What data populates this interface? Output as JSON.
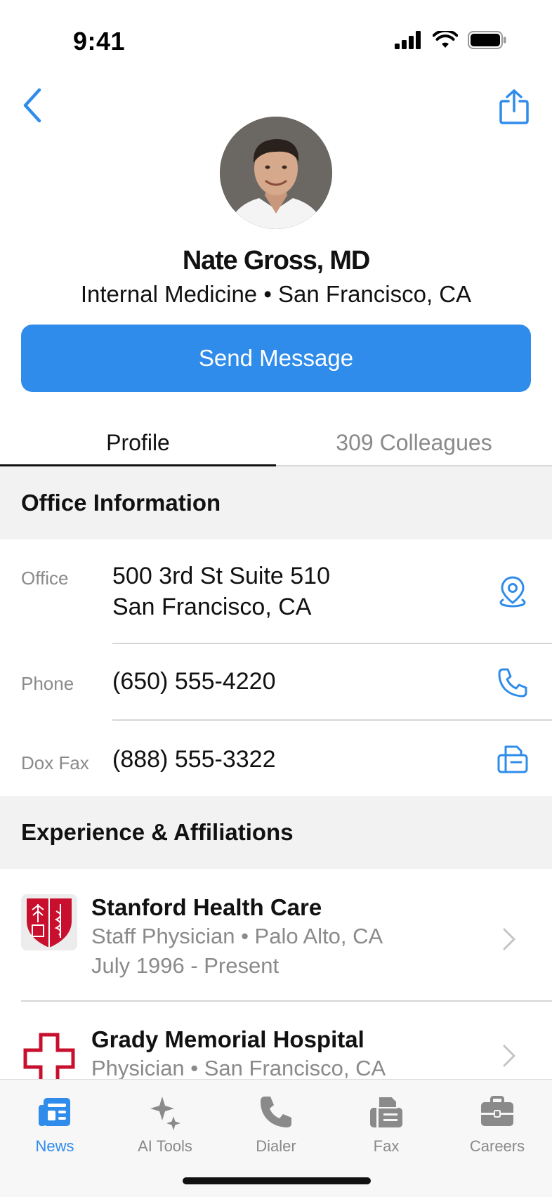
{
  "status": {
    "time": "9:41"
  },
  "profile": {
    "name": "Nate Gross, MD",
    "subtitle": "Internal Medicine • San Francisco, CA",
    "send_label": "Send Message"
  },
  "tabs": [
    {
      "label": "Profile",
      "active": true
    },
    {
      "label": "309 Colleagues",
      "active": false
    }
  ],
  "office": {
    "header": "Office Information",
    "rows": [
      {
        "label": "Office",
        "value_line1": "500 3rd St Suite 510",
        "value_line2": "San Francisco, CA",
        "icon": "location-pin-icon"
      },
      {
        "label": "Phone",
        "value_line1": "(650) 555-4220",
        "icon": "phone-icon"
      },
      {
        "label": "Dox Fax",
        "value_line1": "(888) 555-3322",
        "icon": "fax-icon"
      }
    ]
  },
  "experience": {
    "header": "Experience & Affiliations",
    "items": [
      {
        "title": "Stanford Health Care",
        "line1": "Staff Physician • Palo Alto, CA",
        "line2": "July 1996 - Present",
        "logo": "stanford-shield-logo"
      },
      {
        "title": "Grady Memorial Hospital",
        "line1": "Physician • San Francisco, CA",
        "logo": "red-cross-logo"
      }
    ]
  },
  "tab_bar": [
    {
      "label": "News",
      "icon": "newspaper-icon",
      "active": true
    },
    {
      "label": "AI Tools",
      "icon": "sparkles-icon",
      "active": false
    },
    {
      "label": "Dialer",
      "icon": "phone-icon",
      "active": false
    },
    {
      "label": "Fax",
      "icon": "fax-icon",
      "active": false
    },
    {
      "label": "Careers",
      "icon": "briefcase-icon",
      "active": false
    }
  ],
  "colors": {
    "accent": "#2f8ceb",
    "section_bg": "#f2f2f2",
    "muted_text": "#8a8a8a",
    "logo_red": "#c8102e"
  }
}
